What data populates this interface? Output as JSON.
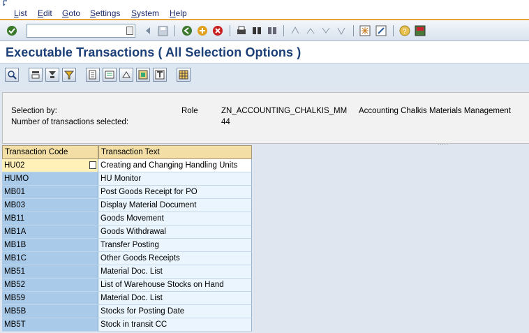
{
  "menu": [
    {
      "label": "List"
    },
    {
      "label": "Edit"
    },
    {
      "label": "Goto"
    },
    {
      "label": "Settings"
    },
    {
      "label": "System"
    },
    {
      "label": "Help"
    }
  ],
  "command_field": {
    "value": ""
  },
  "title": "Executable Transactions ( All Selection Options )",
  "header": {
    "selection_label": "Selection by:",
    "role_label": "Role",
    "role_value": "ZN_ACCOUNTING_CHALKIS_MM",
    "role_description": "Accounting Chalkis Materials Management",
    "count_label": "Number of transactions selected:",
    "count_value": "44",
    "splitter": "....."
  },
  "table": {
    "columns": [
      "Transaction Code",
      "Transaction Text"
    ],
    "rows": [
      {
        "code": "HU02",
        "text": "Creating and Changing Handling Units"
      },
      {
        "code": "HUMO",
        "text": "HU Monitor"
      },
      {
        "code": "MB01",
        "text": "Post Goods Receipt for PO"
      },
      {
        "code": "MB03",
        "text": "Display Material Document"
      },
      {
        "code": "MB11",
        "text": "Goods Movement"
      },
      {
        "code": "MB1A",
        "text": "Goods Withdrawal"
      },
      {
        "code": "MB1B",
        "text": "Transfer Posting"
      },
      {
        "code": "MB1C",
        "text": "Other Goods Receipts"
      },
      {
        "code": "MB51",
        "text": "Material Doc. List"
      },
      {
        "code": "MB52",
        "text": "List of Warehouse Stocks on Hand"
      },
      {
        "code": "MB59",
        "text": "Material Doc. List"
      },
      {
        "code": "MB5B",
        "text": "Stocks for Posting Date"
      },
      {
        "code": "MB5T",
        "text": "Stock in transit CC"
      }
    ]
  },
  "colors": {
    "title": "#1c3f77",
    "menu_underline": "#e8a33a",
    "code_column": "#a9cbe9",
    "text_column": "#eaf5fd",
    "header_cell": "#f3dfa6"
  },
  "icons": {
    "std_toolbar": [
      "enter-icon",
      "save-icon",
      "back-icon",
      "exit-icon",
      "cancel-icon",
      "print-icon",
      "find-icon",
      "find-next-icon",
      "first-page-icon",
      "previous-page-icon",
      "next-page-icon",
      "last-page-icon",
      "create-session-icon",
      "shortcut-icon",
      "help-icon",
      "layout-menu-icon"
    ],
    "app_toolbar": [
      "details-icon",
      "sort-ascending-icon",
      "sort-descending-icon",
      "filter-icon",
      "print-preview-icon",
      "export-icon",
      "email-icon",
      "abc-analysis-icon",
      "change-layout-icon",
      "select-layout-icon"
    ]
  }
}
